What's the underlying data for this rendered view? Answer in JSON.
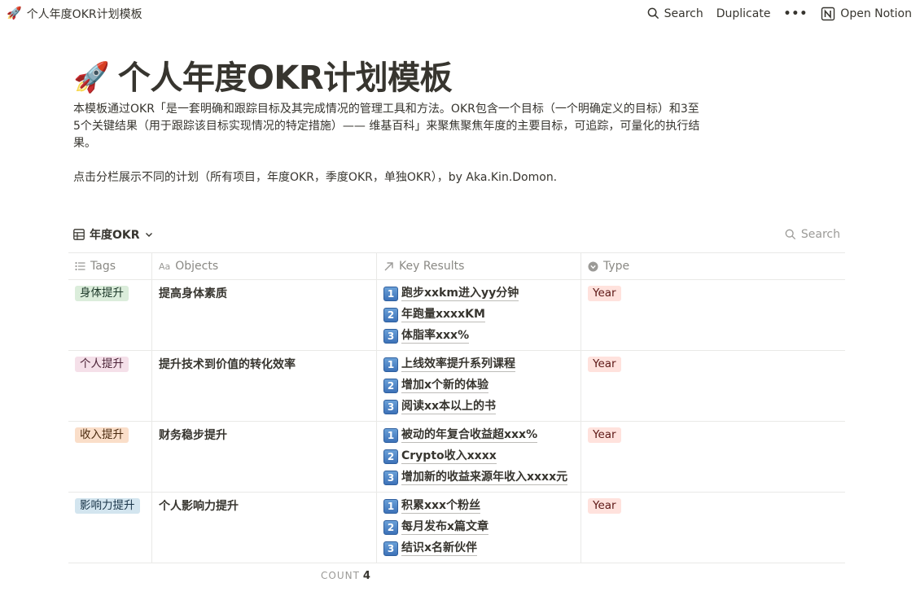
{
  "topbar": {
    "rocket_emoji": "🚀",
    "page_title": "个人年度OKR计划模板",
    "search_label": "Search",
    "duplicate_label": "Duplicate",
    "more_label": "•••",
    "open_notion_label": "Open Notion"
  },
  "page": {
    "emoji": "🚀",
    "title": "个人年度OKR计划模板",
    "description": "本模板通过OKR「是一套明确和跟踪目标及其完成情况的管理工具和方法。OKR包含一个目标（一个明确定义的目标）和3至5个关键结果（用于跟踪该目标实现情况的特定措施）—— 维基百科」来聚焦聚焦年度的主要目标，可追踪，可量化的执行结果。",
    "note": "点击分栏展示不同的计划（所有项目，年度OKR，季度OKR，单独OKR），by Aka.Kin.Domon."
  },
  "view": {
    "tab_label": "年度OKR",
    "search_label": "Search"
  },
  "table": {
    "columns": [
      "Tags",
      "Objects",
      "Key Results",
      "Type"
    ],
    "rows": [
      {
        "tag": "身体提升",
        "tag_bg": "#dbeddb",
        "tag_fg": "#1c3829",
        "object": "提高身体素质",
        "key_results": [
          "跑步xxkm进入yy分钟",
          "年跑量xxxxKM",
          "体脂率xxx%"
        ],
        "type": "Year"
      },
      {
        "tag": "个人提升",
        "tag_bg": "#f5e0e9",
        "tag_fg": "#4c2337",
        "object": "提升技术到价值的转化效率",
        "key_results": [
          "上线效率提升系列课程",
          "增加x个新的体验",
          "阅读xx本以上的书"
        ],
        "type": "Year"
      },
      {
        "tag": "收入提升",
        "tag_bg": "#fadec9",
        "tag_fg": "#49290e",
        "object": "财务稳步提升",
        "key_results": [
          "被动的年复合收益超xxx%",
          "Crypto收入xxxx",
          "增加新的收益来源年收入xxxx元"
        ],
        "type": "Year"
      },
      {
        "tag": "影响力提升",
        "tag_bg": "#d3e5ef",
        "tag_fg": "#183347",
        "object": "个人影响力提升",
        "key_results": [
          "积累xxx个粉丝",
          "每月发布x篇文章",
          "结识x名新伙伴"
        ],
        "type": "Year"
      }
    ],
    "type_bg": "#ffe2dd",
    "type_fg": "#5d1715",
    "number_badges": [
      "1",
      "2",
      "3"
    ]
  },
  "footer": {
    "count_label": "COUNT",
    "count_value": "4"
  }
}
